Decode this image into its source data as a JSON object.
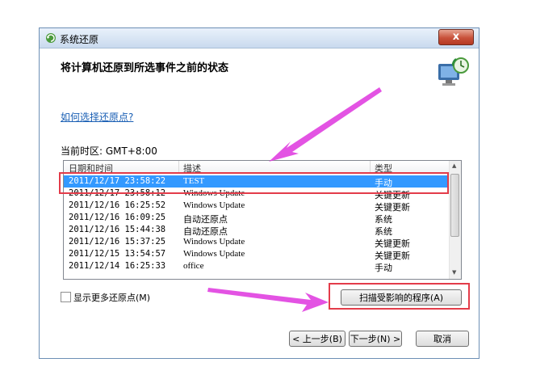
{
  "window": {
    "title": "系统还原",
    "close_label": "x",
    "heading": "将计算机还原到所选事件之前的状态",
    "help_link": "如何选择还原点?",
    "timezone": "当前时区: GMT+8:00"
  },
  "table": {
    "columns": [
      "日期和时间",
      "描述",
      "类型"
    ],
    "rows": [
      [
        "2011/12/17 23:58:22",
        "TEST",
        "手动"
      ],
      [
        "2011/12/17 23:58:12",
        "Windows Update",
        "关键更新"
      ],
      [
        "2011/12/16 16:25:52",
        "Windows Update",
        "关键更新"
      ],
      [
        "2011/12/16 16:09:25",
        "自动还原点",
        "系统"
      ],
      [
        "2011/12/16 15:44:38",
        "自动还原点",
        "系统"
      ],
      [
        "2011/12/16 15:37:25",
        "Windows Update",
        "关键更新"
      ],
      [
        "2011/12/15 13:54:57",
        "Windows Update",
        "关键更新"
      ],
      [
        "2011/12/14 16:25:33",
        "office",
        "手动"
      ]
    ],
    "selected_row": 0
  },
  "options": {
    "show_more_label": "显示更多还原点(M)",
    "show_more_checked": false
  },
  "buttons": {
    "scan_label": "扫描受影响的程序(A)",
    "back_label": "< 上一步(B)",
    "next_label": "下一步(N) >",
    "cancel_label": "取消"
  },
  "colors": {
    "selection": "#3399ff",
    "highlight_box": "#e33c4a",
    "annotation_arrow": "#e040e0"
  }
}
